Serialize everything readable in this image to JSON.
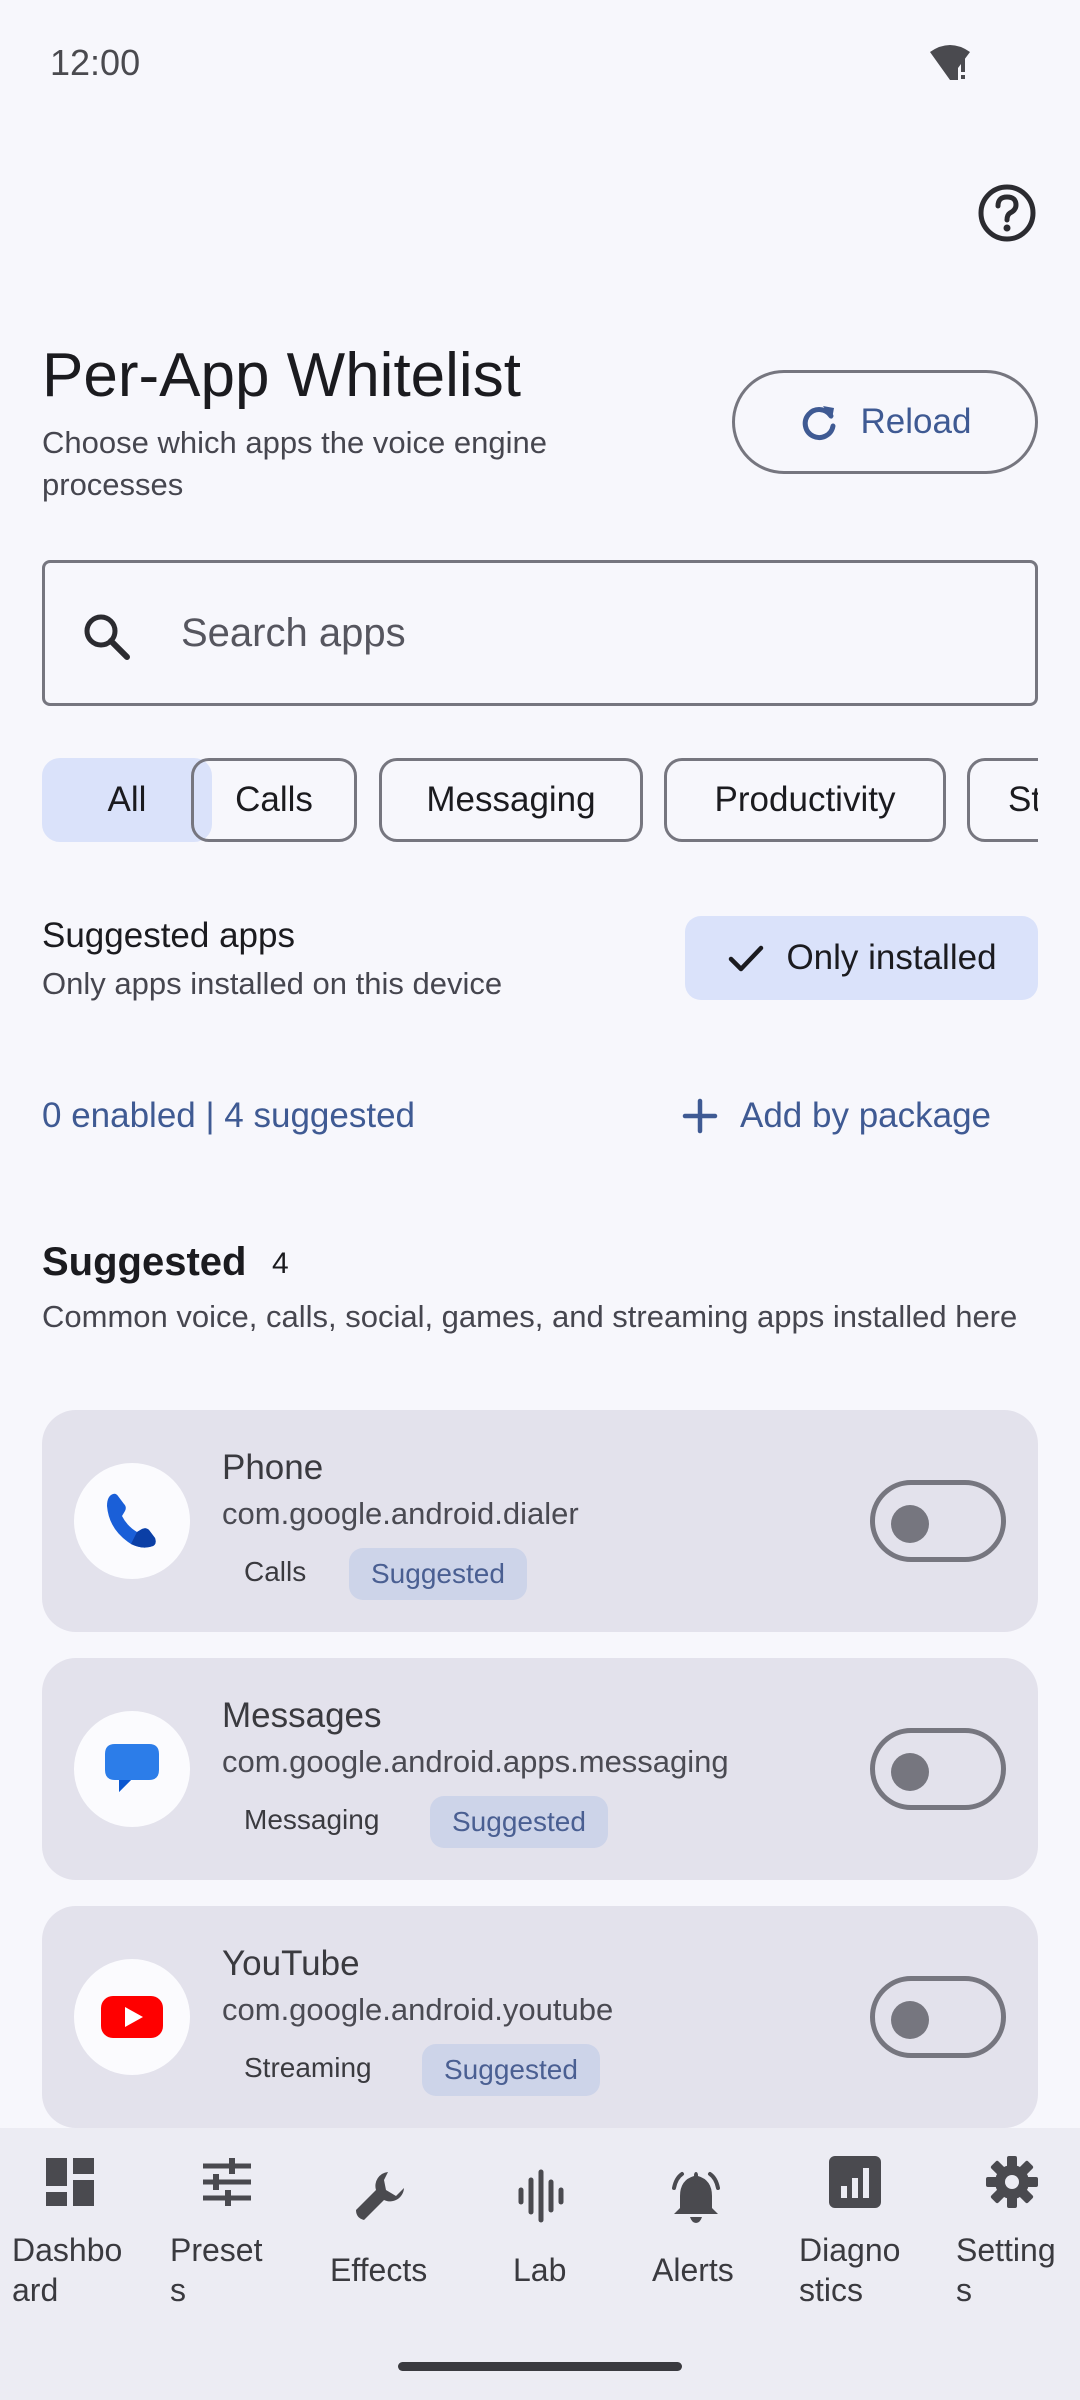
{
  "status_bar": {
    "time": "12:00"
  },
  "header": {
    "title": "Per-App Whitelist",
    "subtitle": "Choose which apps the voice engine processes",
    "reload_label": "Reload"
  },
  "search": {
    "placeholder": "Search apps"
  },
  "filter_chips": [
    {
      "label": "All",
      "selected": true
    },
    {
      "label": "Calls",
      "selected": false
    },
    {
      "label": "Messaging",
      "selected": false
    },
    {
      "label": "Productivity",
      "selected": false
    },
    {
      "label": "St",
      "selected": false
    }
  ],
  "suggested_filter": {
    "title": "Suggested apps",
    "subtitle": "Only apps installed on this device",
    "toggle_label": "Only installed"
  },
  "summary": {
    "counts": "0 enabled | 4 suggested",
    "add_label": "Add by package"
  },
  "section": {
    "title": "Suggested",
    "count": "4",
    "description": "Common voice, calls, social, games, and streaming apps installed here"
  },
  "apps": [
    {
      "name": "Phone",
      "package": "com.google.android.dialer",
      "category": "Calls",
      "tag": "Suggested",
      "icon": "phone-icon",
      "enabled": false
    },
    {
      "name": "Messages",
      "package": "com.google.android.apps.messaging",
      "category": "Messaging",
      "tag": "Suggested",
      "icon": "messages-icon",
      "enabled": false
    },
    {
      "name": "YouTube",
      "package": "com.google.android.youtube",
      "category": "Streaming",
      "tag": "Suggested",
      "icon": "youtube-icon",
      "enabled": false
    }
  ],
  "bottom_nav": [
    {
      "label": "Dashbo\nard",
      "icon": "dashboard-icon"
    },
    {
      "label": "Preset\ns",
      "icon": "tune-icon"
    },
    {
      "label": "Effects",
      "icon": "wrench-icon"
    },
    {
      "label": "Lab",
      "icon": "waveform-icon"
    },
    {
      "label": "Alerts",
      "icon": "bell-icon"
    },
    {
      "label": "Diagno\nstics",
      "icon": "chart-icon"
    },
    {
      "label": "Setting\ns",
      "icon": "gear-icon"
    }
  ],
  "colors": {
    "accent": "#3f5a93",
    "chip_selected": "#dae2fa",
    "card": "#e3e2ec",
    "tag": "#cdd4e9",
    "youtube_red": "#ff0000",
    "phone_blue": "#1a5fd8"
  }
}
